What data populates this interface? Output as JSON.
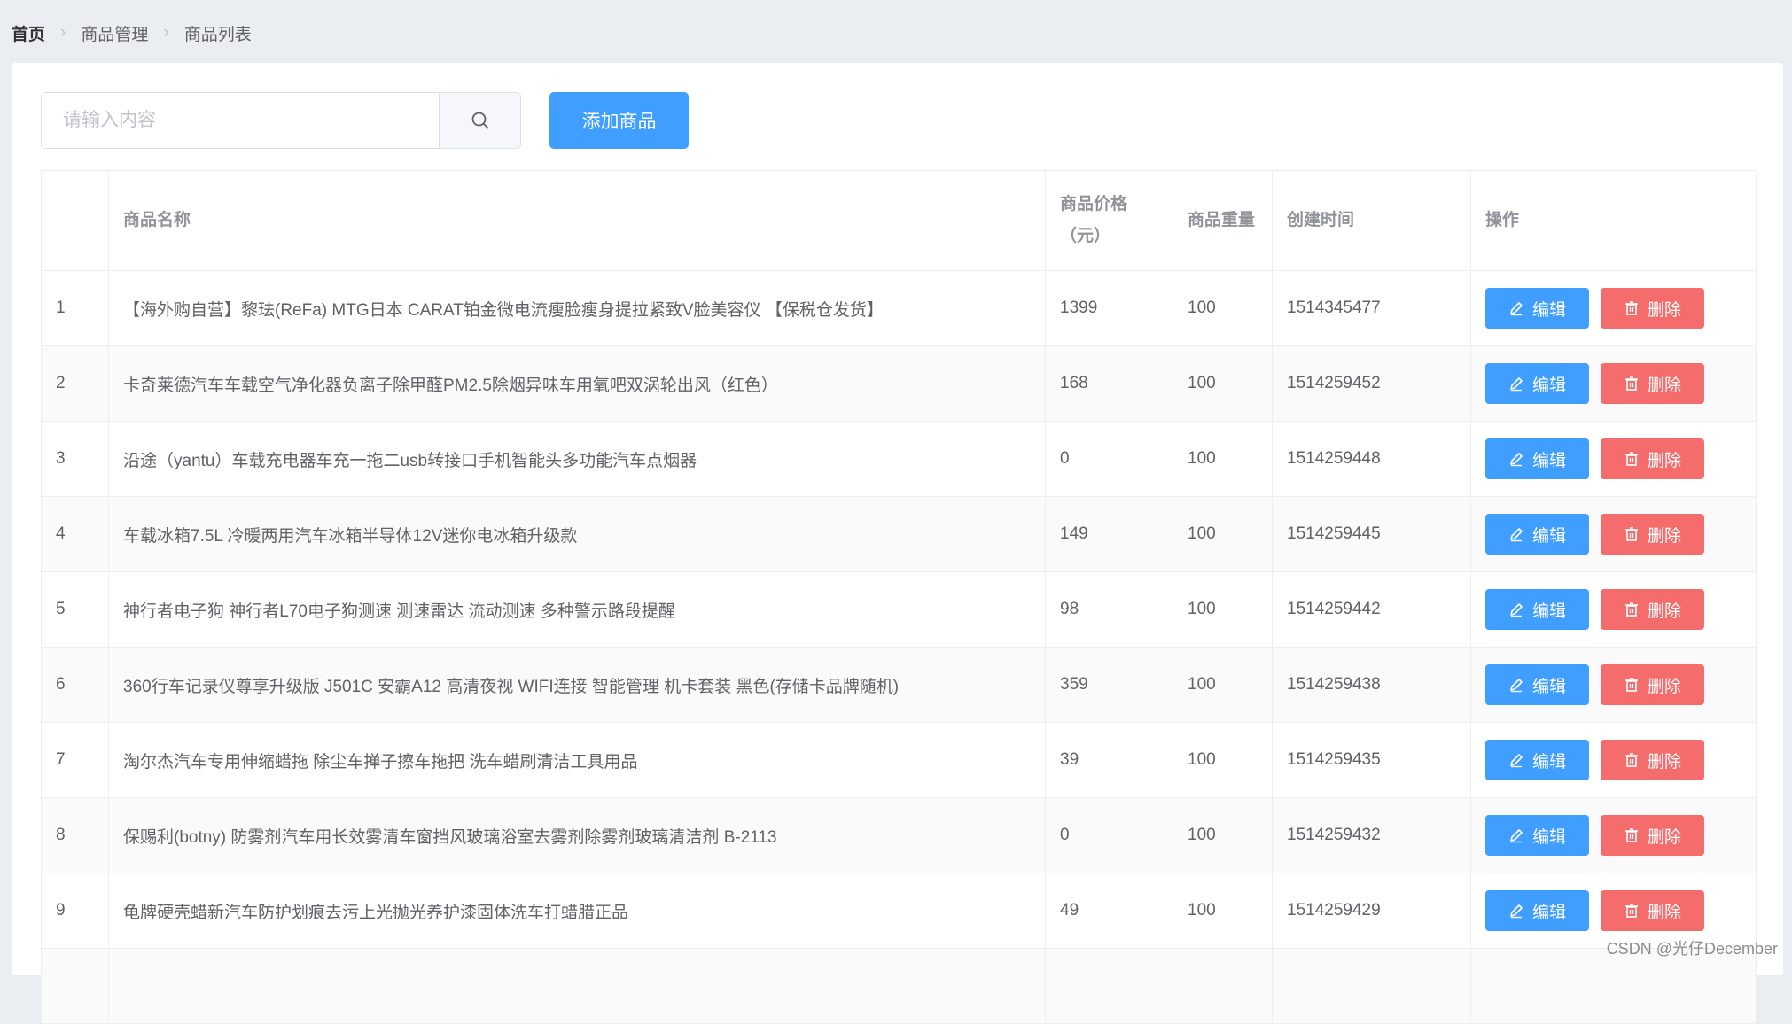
{
  "breadcrumb": [
    "首页",
    "商品管理",
    "商品列表"
  ],
  "toolbar": {
    "search_placeholder": "请输入内容",
    "search_value": "",
    "add_label": "添加商品"
  },
  "table": {
    "headers": {
      "name": "商品名称",
      "price_line1": "商品价格",
      "price_line2": "（元）",
      "weight": "商品重量",
      "created": "创建时间",
      "ops": "操作"
    },
    "edit_label": "编辑",
    "delete_label": "删除",
    "rows": [
      {
        "idx": "1",
        "name": "【海外购自营】黎珐(ReFa) MTG日本 CARAT铂金微电流瘦脸瘦身提拉紧致V脸美容仪 【保税仓发货】",
        "price": "1399",
        "weight": "100",
        "created": "1514345477"
      },
      {
        "idx": "2",
        "name": "卡奇莱德汽车车载空气净化器负离子除甲醛PM2.5除烟异味车用氧吧双涡轮出风（红色）",
        "price": "168",
        "weight": "100",
        "created": "1514259452"
      },
      {
        "idx": "3",
        "name": "沿途（yantu）车载充电器车充一拖二usb转接口手机智能头多功能汽车点烟器",
        "price": "0",
        "weight": "100",
        "created": "1514259448"
      },
      {
        "idx": "4",
        "name": "车载冰箱7.5L 冷暖两用汽车冰箱半导体12V迷你电冰箱升级款",
        "price": "149",
        "weight": "100",
        "created": "1514259445"
      },
      {
        "idx": "5",
        "name": "神行者电子狗 神行者L70电子狗测速 测速雷达 流动测速 多种警示路段提醒",
        "price": "98",
        "weight": "100",
        "created": "1514259442"
      },
      {
        "idx": "6",
        "name": "360行车记录仪尊享升级版 J501C 安霸A12 高清夜视 WIFI连接 智能管理 机卡套装 黑色(存储卡品牌随机)",
        "price": "359",
        "weight": "100",
        "created": "1514259438"
      },
      {
        "idx": "7",
        "name": "淘尔杰汽车专用伸缩蜡拖 除尘车掸子擦车拖把 洗车蜡刷清洁工具用品",
        "price": "39",
        "weight": "100",
        "created": "1514259435"
      },
      {
        "idx": "8",
        "name": "保赐利(botny) 防雾剂汽车用长效雾清车窗挡风玻璃浴室去雾剂除雾剂玻璃清洁剂 B-2113",
        "price": "0",
        "weight": "100",
        "created": "1514259432"
      },
      {
        "idx": "9",
        "name": "龟牌硬壳蜡新汽车防护划痕去污上光抛光养护漆固体洗车打蜡腊正品",
        "price": "49",
        "weight": "100",
        "created": "1514259429"
      },
      {
        "idx": "",
        "name": "",
        "price": "",
        "weight": "",
        "created": ""
      }
    ]
  },
  "watermark": "CSDN @光仔December"
}
